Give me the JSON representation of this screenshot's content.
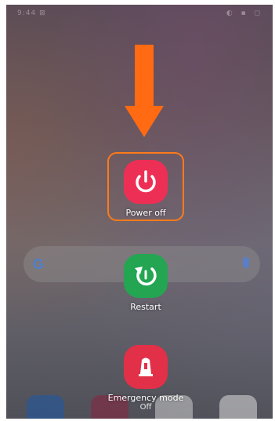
{
  "status_bar": {
    "time": "9:44 ⊠",
    "icons": "◐ ▪ ◻"
  },
  "search_bar": {
    "logo": "G"
  },
  "power_menu": {
    "options": [
      {
        "label": "Power off",
        "sub": "",
        "color": "#ee2f55",
        "icon": "power-icon"
      },
      {
        "label": "Restart",
        "sub": "",
        "color": "#23a552",
        "icon": "restart-icon"
      },
      {
        "label": "Emergency mode",
        "sub": "Off",
        "color": "#e23048",
        "icon": "emergency-icon"
      }
    ],
    "highlight_color": "#ff7a1a"
  },
  "annotation": {
    "arrow_color": "#ff6a13"
  },
  "dock": {
    "apps": [
      "meet-icon",
      "photos-icon",
      "play-store-icon",
      "folder-icon"
    ]
  }
}
